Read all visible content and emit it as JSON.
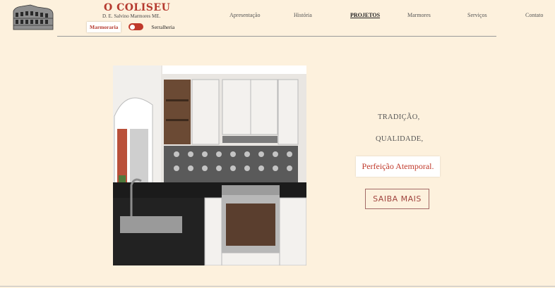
{
  "header": {
    "brand_title": "O COLISEU",
    "brand_subtitle": "D. E. Salvino Marmores ME.",
    "toggle_left_label": "Marmoraria",
    "toggle_right_label": "Serralheria"
  },
  "nav": {
    "items": [
      {
        "label": "Apresentação"
      },
      {
        "label": "História"
      },
      {
        "label": "PROJETOS"
      },
      {
        "label": "Marmores"
      },
      {
        "label": "Serviços"
      },
      {
        "label": "Contato"
      }
    ],
    "active_index": 2
  },
  "hero": {
    "image_semantic": "kitchen-photo",
    "line1": "TRADIÇÃO,",
    "line2": "QUALIDADE,",
    "highlight": "Perfeição Atemporal.",
    "cta_label": "SAIBA MAIS"
  },
  "colors": {
    "background": "#fdf1dd",
    "brand_red": "#b53a2f",
    "toggle": "#c0392b",
    "cta_border": "#a26a66"
  }
}
